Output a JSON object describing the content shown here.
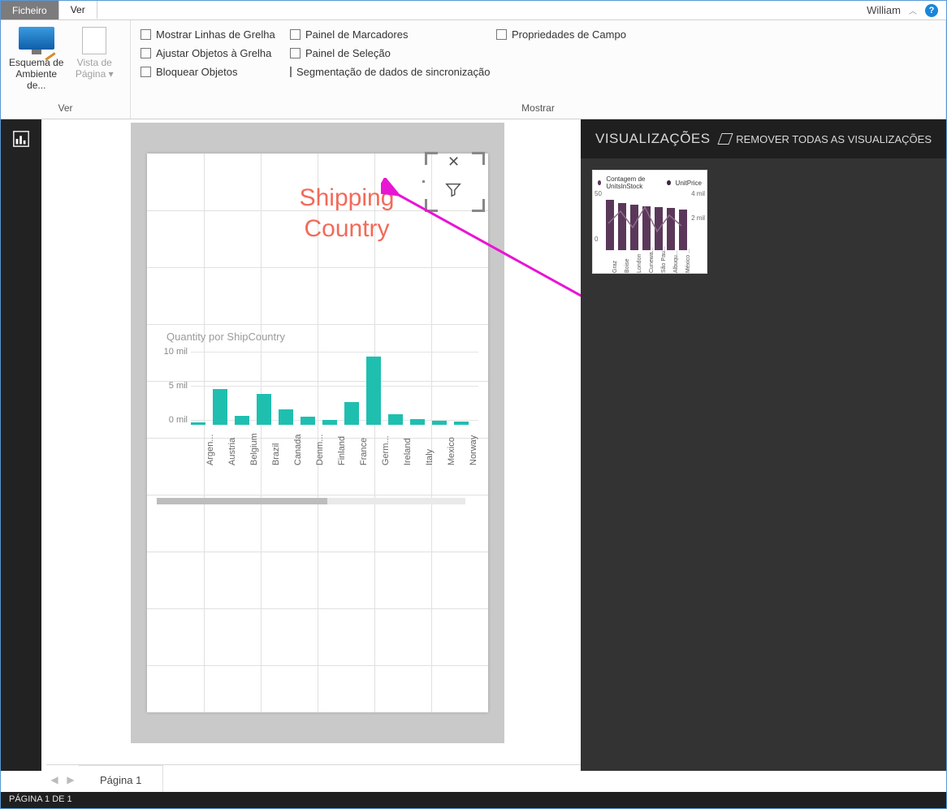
{
  "window": {
    "user": "William"
  },
  "tabs": {
    "file": "Ficheiro",
    "view": "Ver"
  },
  "ribbon": {
    "group_ver": "Ver",
    "group_mostrar": "Mostrar",
    "layout_btn": "Esquema de Ambiente de...",
    "page_view_btn": "Vista de Página",
    "checks_col1": [
      "Mostrar Linhas de Grelha",
      "Ajustar Objetos à Grelha",
      "Bloquear Objetos"
    ],
    "checks_col2": [
      "Painel de Marcadores",
      "Painel de Seleção",
      "Segmentação de dados de sincronização"
    ],
    "checks_col3": [
      "Propriedades de Campo"
    ]
  },
  "page": {
    "title_text": "Shipping Country",
    "tab_label": "Página 1"
  },
  "chart_data": {
    "type": "bar",
    "title": "Quantity por ShipCountry",
    "ylabel": "",
    "ylim": [
      0,
      10000
    ],
    "yticks": [
      "10 mil",
      "5 mil",
      "0 mil"
    ],
    "categories": [
      "Argen...",
      "Austria",
      "Belgium",
      "Brazil",
      "Canada",
      "Denm...",
      "Finland",
      "France",
      "Germ...",
      "Ireland",
      "Italy",
      "Mexico",
      "Norway"
    ],
    "values": [
      300,
      5000,
      1200,
      4300,
      2200,
      1100,
      700,
      3200,
      9500,
      1500,
      800,
      600,
      400
    ]
  },
  "viz_pane": {
    "title": "VISUALIZAÇÕES",
    "remove_all": "REMOVER TODAS AS VISUALIZAÇÕES",
    "thumb_legend": [
      "Contagem de UnitsInStock",
      "UnitPrice"
    ],
    "thumb_yticks_left": [
      "50",
      "0"
    ],
    "thumb_yticks_right": [
      "4 mil",
      "2 mil"
    ],
    "thumb_categories": [
      "Graz",
      "Boise",
      "London",
      "Cunewa...",
      "São Pau...",
      "Albuqu...",
      "México ..."
    ],
    "thumb_values": [
      52,
      48,
      47,
      45,
      44,
      43,
      42
    ]
  },
  "status": {
    "text": "PÁGINA 1 DE 1"
  }
}
